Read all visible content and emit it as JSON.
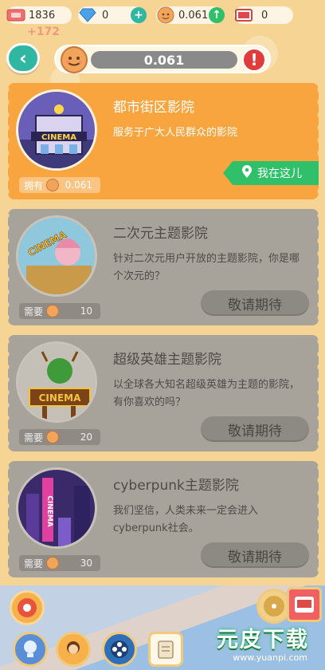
{
  "stats": {
    "tickets": "1836",
    "tickets_floater": "+172",
    "diamonds": "0",
    "coins": "0.061",
    "film": "0"
  },
  "header": {
    "coin_value": "0.061",
    "alert": "!"
  },
  "cards": [
    {
      "title": "都市街区影院",
      "desc": "服务于广大人民群众的影院",
      "badge_label": "拥有",
      "badge_value": "0.061",
      "action": "我在这儿",
      "poster_text": "CINEMA"
    },
    {
      "title": "二次元主题影院",
      "desc": "针对二次元用户开放的主题影院，你是哪个次元的？",
      "badge_label": "需要",
      "badge_value": "10",
      "action": "敬请期待",
      "poster_text": "CINEMA"
    },
    {
      "title": "超级英雄主题影院",
      "desc": "以全球各大知名超级英雄为主题的影院，有你喜欢的吗？",
      "badge_label": "需要",
      "badge_value": "20",
      "action": "敬请期待",
      "poster_text": "CINEMA"
    },
    {
      "title": "cyberpunk主题影院",
      "desc": "我们坚信，人类未来一定会进入cyberpunk社会。",
      "badge_label": "需要",
      "badge_value": "30",
      "action": "敬请期待",
      "poster_text": "CINEMA"
    }
  ],
  "watermark": {
    "title": "元皮下载",
    "url": "www.yuanpi.com"
  },
  "colors": {
    "accent_teal": "#2fb7a2",
    "active_card": "#f9a53f",
    "locked_card": "#a7a39b",
    "here_green": "#2fc069"
  }
}
